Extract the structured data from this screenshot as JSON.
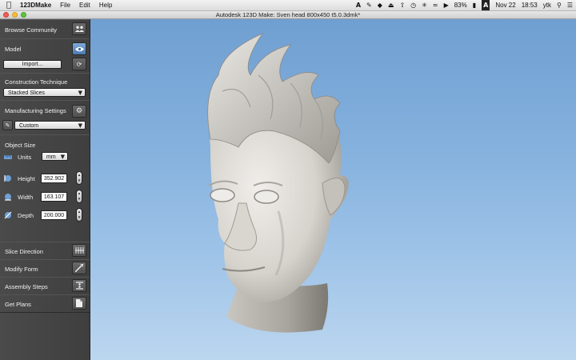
{
  "menubar": {
    "app_name": "123DMake",
    "menus": [
      "File",
      "Edit",
      "Help"
    ],
    "battery": "83%",
    "date": "Nov 22",
    "time": "18:53",
    "user": "ytk"
  },
  "window": {
    "title": "Autodesk 123D Make: Sven head 800x450 t5.0.3dmk*"
  },
  "sidebar": {
    "browse_community": "Browse Community",
    "model": {
      "label": "Model",
      "import_button": "Import..."
    },
    "construction_technique": {
      "label": "Construction Technique",
      "value": "Stacked Slices"
    },
    "manufacturing_settings": {
      "label": "Manufacturing Settings",
      "value": "Custom"
    },
    "object_size": {
      "label": "Object Size",
      "units_label": "Units",
      "units_value": "mm",
      "height_label": "Height",
      "height_value": "352.902",
      "width_label": "Width",
      "width_value": "163.107",
      "depth_label": "Depth",
      "depth_value": "200.000"
    },
    "slice_direction": "Slice Direction",
    "modify_form": "Modify Form",
    "assembly_steps": "Assembly Steps",
    "get_plans": "Get Plans"
  },
  "colors": {
    "sidebar_bg": "#434343",
    "viewport_top": "#6f9fd1",
    "viewport_bottom": "#bcd6ef",
    "model_color": "#d9d7d2",
    "accent_blue": "#4a79b1"
  }
}
